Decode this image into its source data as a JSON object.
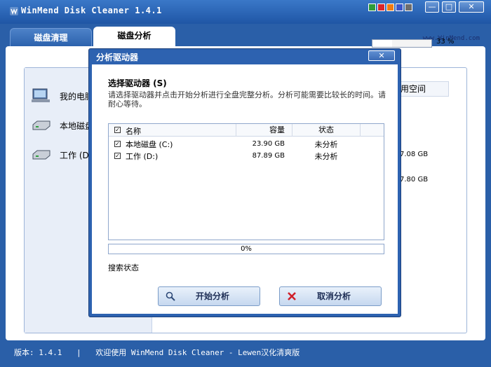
{
  "window": {
    "title": "WinMend Disk Cleaner 1.4.1",
    "url_label": "www.WinMend.com",
    "skin_colors": [
      "#2e9b3a",
      "#d9262c",
      "#f07c12",
      "#3b55c8",
      "#6d6d6d"
    ],
    "minimize_label": "—",
    "maximize_label": "□",
    "close_label": "✕"
  },
  "tabs": [
    {
      "label": "磁盘清理",
      "active": false
    },
    {
      "label": "磁盘分析",
      "active": true
    }
  ],
  "sidebar": {
    "items": [
      {
        "label": "我的电脑",
        "icon": "computer-icon"
      },
      {
        "label": "本地磁盘",
        "icon": "hard-drive-icon"
      },
      {
        "label": "工作 (D",
        "icon": "hard-drive-icon"
      }
    ]
  },
  "background_panel": {
    "progress_percent_label": "33 %",
    "progress_fraction": 0.33,
    "column_header": "用空间",
    "values": [
      "7.08 GB",
      "7.80 GB"
    ]
  },
  "dialog": {
    "title": "分析驱动器",
    "close_label": "✕",
    "heading": "选择驱动器 (S)",
    "description": "请选择驱动器并点击开始分析进行全盘完整分析。分析可能需要比较长的时间。请耐心等待。",
    "columns": {
      "name": "名称",
      "capacity": "容量",
      "status": "状态"
    },
    "drives": [
      {
        "name": "本地磁盘  (C:)",
        "capacity": "23.90 GB",
        "status": "未分析",
        "checked": true
      },
      {
        "name": "工作  (D:)",
        "capacity": "87.89 GB",
        "status": "未分析",
        "checked": true
      }
    ],
    "progress_label": "0%",
    "progress_fraction": 0,
    "search_status_label": "搜索状态",
    "start_button": "开始分析",
    "cancel_button": "取消分析"
  },
  "statusbar": {
    "version_label": "版本: 1.4.1",
    "separator": "|",
    "welcome": "欢迎使用 WinMend Disk Cleaner - Lewen汉化清爽版"
  }
}
